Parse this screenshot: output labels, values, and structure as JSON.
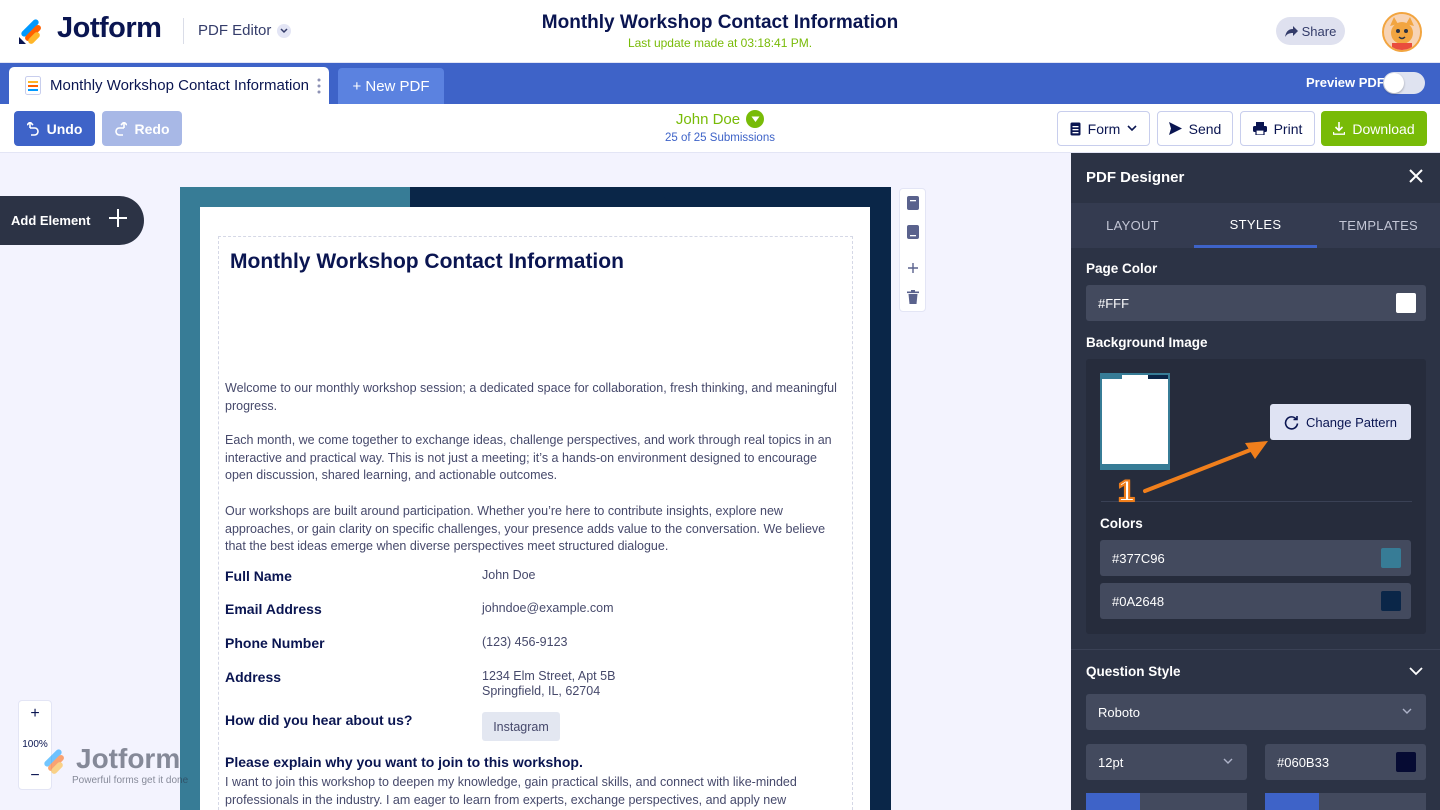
{
  "header": {
    "logo_text": "Jotform",
    "app_switcher": "PDF Editor",
    "doc_title": "Monthly Workshop Contact Information",
    "last_update": "Last update made at 03:18:41 PM.",
    "share_label": "Share"
  },
  "tabs": {
    "active_label": "Monthly Workshop Contact Information",
    "new_pdf_label": "+ New PDF",
    "preview_label": "Preview PDF"
  },
  "toolbar": {
    "undo_label": "Undo",
    "redo_label": "Redo",
    "submitter": "John Doe",
    "submission_count": "25 of 25 Submissions",
    "form_label": "Form",
    "send_label": "Send",
    "print_label": "Print",
    "download_label": "Download"
  },
  "left": {
    "add_element_label": "Add Element",
    "zoom_plus": "+",
    "zoom_value": "100%",
    "zoom_minus": "−",
    "watermark_text": "Jotform",
    "watermark_sub": "Powerful forms get it done"
  },
  "document": {
    "title": "Monthly Workshop Contact Information",
    "paragraphs": [
      "Welcome to our monthly workshop session; a dedicated space for collaboration, fresh thinking, and meaningful progress.",
      "Each month, we come together to exchange ideas, challenge perspectives, and work through real topics in an interactive and practical way. This is not just a meeting; it’s a hands-on environment designed to encourage open discussion, shared learning, and actionable outcomes.",
      "Our workshops are built around participation. Whether you’re here to contribute insights, explore new approaches, or gain clarity on specific challenges, your presence adds value to the conversation. We believe that the best ideas emerge when diverse perspectives meet structured dialogue."
    ],
    "fields": [
      {
        "label": "Full Name",
        "value": "John Doe"
      },
      {
        "label": "Email Address",
        "value": "johndoe@example.com"
      },
      {
        "label": "Phone Number",
        "value": "(123) 456-9123"
      },
      {
        "label": "Address",
        "value": "1234 Elm Street, Apt 5B",
        "value2": "Springfield, IL, 62704"
      },
      {
        "label": "How did you hear about us?",
        "value": "Instagram"
      }
    ],
    "question": "Please explain why you want to join to this workshop.",
    "answer": "I want to join this workshop to deepen my knowledge, gain practical skills, and connect with like-minded professionals in the industry. I am eager to learn from experts, exchange perspectives, and apply new"
  },
  "panel": {
    "title": "PDF Designer",
    "tabs": [
      "LAYOUT",
      "STYLES",
      "TEMPLATES"
    ],
    "active_tab": "STYLES",
    "page_color_label": "Page Color",
    "page_color_value": "#FFF",
    "bg_image_label": "Background Image",
    "change_pattern_label": "Change Pattern",
    "annotation_number": "1",
    "colors_label": "Colors",
    "color1": "#377C96",
    "color2": "#0A2648",
    "question_style_label": "Question Style",
    "font_value": "Roboto",
    "size_value": "12pt",
    "text_color_value": "#060B33"
  },
  "colors": {
    "brand_blue": "#3e63c8",
    "brand_green": "#78bb07",
    "panel_bg": "#2c3345",
    "pattern_primary": "#377c96",
    "pattern_secondary": "#0a2648",
    "annotation_orange": "#f07f1c"
  }
}
